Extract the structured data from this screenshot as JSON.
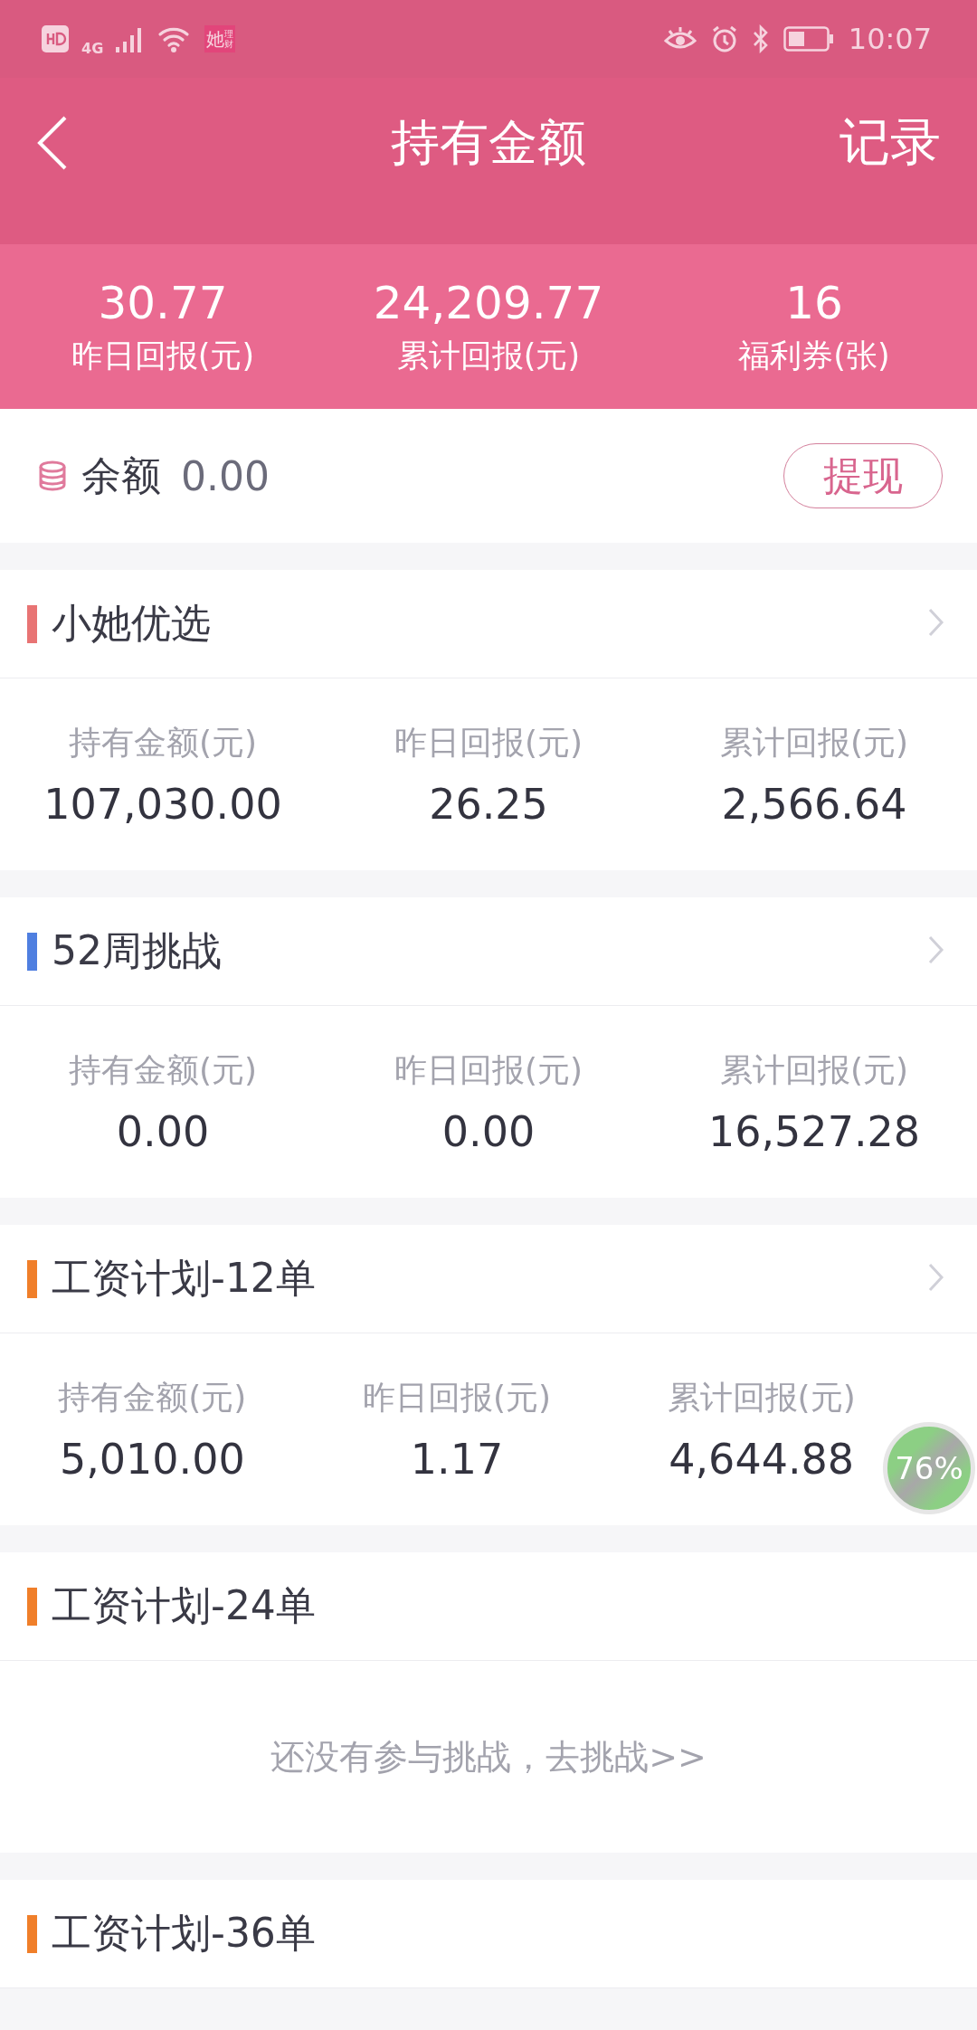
{
  "status_bar": {
    "network": "4G",
    "app_icon": {
      "main": "她",
      "sub": "理财"
    },
    "time": "10:07"
  },
  "header": {
    "title": "持有金额",
    "action": "记录"
  },
  "summary": [
    {
      "value": "30.77",
      "label": "昨日回报(元)"
    },
    {
      "value": "24,209.77",
      "label": "累计回报(元)"
    },
    {
      "value": "16",
      "label": "福利券(张)"
    }
  ],
  "balance": {
    "label": "余额",
    "value": "0.00",
    "button": "提现"
  },
  "sections": [
    {
      "title": "小她优选",
      "color": "#e87474",
      "arrow": true,
      "kind": "stats",
      "stats": [
        {
          "label": "持有金额(元)",
          "value": "107,030.00"
        },
        {
          "label": "昨日回报(元)",
          "value": "26.25"
        },
        {
          "label": "累计回报(元)",
          "value": "2,566.64"
        }
      ]
    },
    {
      "title": "52周挑战",
      "color": "#4f7fe0",
      "arrow": true,
      "kind": "stats",
      "stats": [
        {
          "label": "持有金额(元)",
          "value": "0.00"
        },
        {
          "label": "昨日回报(元)",
          "value": "0.00"
        },
        {
          "label": "累计回报(元)",
          "value": "16,527.28"
        }
      ]
    },
    {
      "title": "工资计划-12单",
      "color": "#f07f2a",
      "arrow": true,
      "kind": "stats",
      "stats": [
        {
          "label": "持有金额(元)",
          "value": "5,010.00"
        },
        {
          "label": "昨日回报(元)",
          "value": "1.17"
        },
        {
          "label": "累计回报(元)",
          "value": "4,644.88"
        }
      ],
      "float_ball": "76%"
    },
    {
      "title": "工资计划-24单",
      "color": "#f07f2a",
      "arrow": false,
      "kind": "empty",
      "message": "还没有参与挑战，去挑战>>"
    },
    {
      "title": "工资计划-36单",
      "color": "#f07f2a",
      "arrow": false,
      "kind": "header_only"
    }
  ]
}
